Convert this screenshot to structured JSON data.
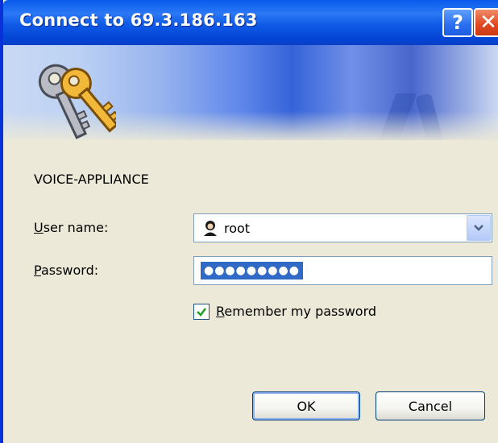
{
  "window": {
    "title": "Connect to 69.3.186.163",
    "help_label": "?",
    "close_label": "✕"
  },
  "realm": "VOICE-APPLIANCE",
  "form": {
    "username_label_accel": "U",
    "username_label_rest": "ser name:",
    "username_value": "root",
    "password_label_accel": "P",
    "password_label_rest": "assword:",
    "password_masked": "●●●●●●●●●",
    "remember_checked": true,
    "remember_label_accel": "R",
    "remember_label_rest": "emember my password"
  },
  "buttons": {
    "ok": "OK",
    "cancel": "Cancel"
  },
  "icons": {
    "banner": "keys-icon",
    "user": "user-icon",
    "dropdown": "chevron-down-icon",
    "check": "check-icon"
  },
  "colors": {
    "title_bar": "#0a5bee",
    "selection": "#316ac5",
    "dialog_bg": "#ece9d8"
  }
}
